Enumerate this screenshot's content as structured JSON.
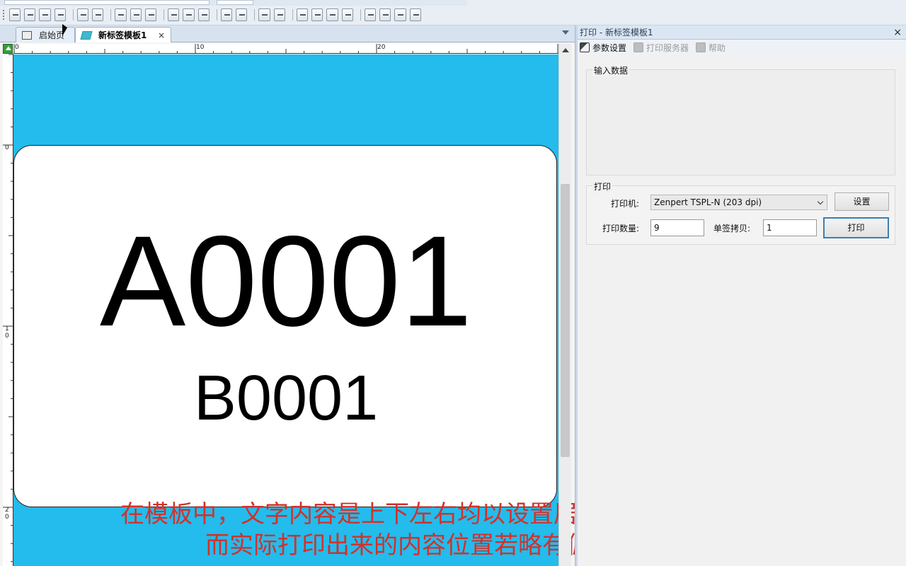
{
  "tabs": [
    {
      "label": "启始页",
      "active": false
    },
    {
      "label": "新标签模板1",
      "active": true,
      "close": "×"
    }
  ],
  "ruler": {
    "h_labels": [
      "0",
      "10",
      "20"
    ],
    "v_labels": [
      "0",
      "1",
      "0",
      "2",
      "0"
    ]
  },
  "label_content": {
    "primary_text": "A0001",
    "secondary_text": "B0001"
  },
  "caption": {
    "line1": "在模板中，文字内容是上下左右均以设置居中与标签",
    "line2": "而实际打印出来的内容位置若略有偏差"
  },
  "panel": {
    "title": "打印 - 新标签模板1",
    "close": "×",
    "toolbar": [
      {
        "label": "参数设置",
        "icon": "wrench-icon",
        "enabled": true
      },
      {
        "label": "打印服务器",
        "icon": "printer-icon",
        "enabled": false
      },
      {
        "label": "帮助",
        "icon": "help-icon",
        "enabled": false
      }
    ],
    "input_group_title": "输入数据",
    "print_group": {
      "title": "打印",
      "printer_label": "打印机:",
      "printer_value": "Zenpert TSPL-N (203 dpi)",
      "settings_button": "设置",
      "quantity_label": "打印数量:",
      "quantity_value": "9",
      "copies_label": "单签拷贝:",
      "copies_value": "1",
      "print_button": "打印"
    }
  },
  "colors": {
    "canvas_bg": "#23bcec",
    "caption": "#d0322c",
    "print_button_border": "#3c7fb1"
  }
}
